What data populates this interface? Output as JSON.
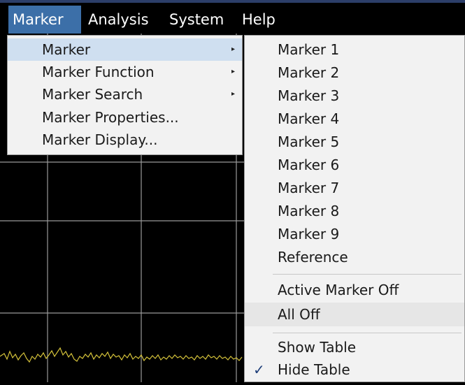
{
  "menubar": {
    "items": [
      {
        "label": "Marker",
        "active": true
      },
      {
        "label": "Analysis",
        "active": false
      },
      {
        "label": "System",
        "active": false
      },
      {
        "label": "Help",
        "active": false
      }
    ]
  },
  "marker_menu": {
    "items": [
      {
        "label": "Marker",
        "has_submenu": true,
        "selected": true
      },
      {
        "label": "Marker Function",
        "has_submenu": true
      },
      {
        "label": "Marker Search",
        "has_submenu": true
      },
      {
        "label": "Marker Properties...",
        "has_submenu": false
      },
      {
        "label": "Marker Display...",
        "has_submenu": false
      }
    ]
  },
  "marker_submenu": {
    "items": [
      {
        "label": "Marker 1"
      },
      {
        "label": "Marker 2"
      },
      {
        "label": "Marker 3"
      },
      {
        "label": "Marker 4"
      },
      {
        "label": "Marker 5"
      },
      {
        "label": "Marker 6"
      },
      {
        "label": "Marker 7"
      },
      {
        "label": "Marker 8"
      },
      {
        "label": "Marker 9"
      },
      {
        "label": "Reference"
      },
      {
        "label": "Active Marker Off"
      },
      {
        "label": "All Off",
        "highlighted": true
      },
      {
        "label": "Show Table"
      },
      {
        "label": "Hide Table",
        "checked": true,
        "check_glyph": "✓"
      }
    ]
  },
  "icons": {
    "submenu_arrow": "▸"
  },
  "colors": {
    "menubar_background": "#000000",
    "menubar_active": "#3c6fa8",
    "menu_background": "#f2f2f2",
    "menu_selected": "#cfdff0",
    "grid_lines": "#9a9a9a",
    "trace": "#d4c23a"
  }
}
